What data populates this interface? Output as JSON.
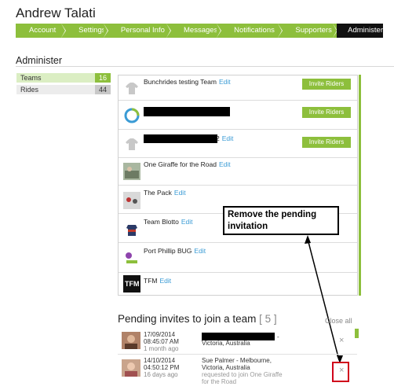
{
  "header": {
    "user_name": "Andrew Talati"
  },
  "nav": {
    "tabs": [
      "Account",
      "Settings",
      "Personal Info",
      "Messages",
      "Notifications",
      "Supporters",
      "Administer"
    ],
    "active": "Administer"
  },
  "section": {
    "title": "Administer"
  },
  "sidebar": {
    "items": [
      {
        "label": "Teams",
        "count": "16"
      },
      {
        "label": "Rides",
        "count": "44"
      }
    ]
  },
  "teams": [
    {
      "name": "Bunchrides testing Team",
      "edit": "Edit",
      "invite": "Invite Riders"
    },
    {
      "name": "",
      "edit": "",
      "invite": "Invite Riders"
    },
    {
      "name": "2",
      "edit": "Edit",
      "invite": "Invite Riders"
    },
    {
      "name": "One Giraffe for the Road",
      "edit": "Edit"
    },
    {
      "name": "The Pack",
      "edit": "Edit"
    },
    {
      "name": "Team Blotto",
      "edit": "Edit"
    },
    {
      "name": "Port Phillip BUG",
      "edit": "Edit"
    },
    {
      "name": "TFM",
      "edit": "Edit"
    }
  ],
  "annotation": {
    "text": "Remove the pending invitation"
  },
  "pending": {
    "title": "Pending invites to join a team",
    "count": "[ 5 ]",
    "close_all": "Close all",
    "invites": [
      {
        "date": "17/09/2014",
        "time": "08:45:07 AM",
        "ago": "1 month ago",
        "line1": "-",
        "line2": "Victoria, Australia",
        "note": "",
        "close": "×"
      },
      {
        "date": "14/10/2014",
        "time": "04:50:12 PM",
        "ago": "16 days ago",
        "line1": "Sue Palmer - Melbourne,",
        "line2": "Victoria, Australia",
        "note": "requested to join One Giraffe for the Road",
        "close": "×"
      }
    ]
  },
  "colors": {
    "accent": "#8dbf3c",
    "link": "#3a9bd5",
    "highlight": "#d0021b"
  }
}
